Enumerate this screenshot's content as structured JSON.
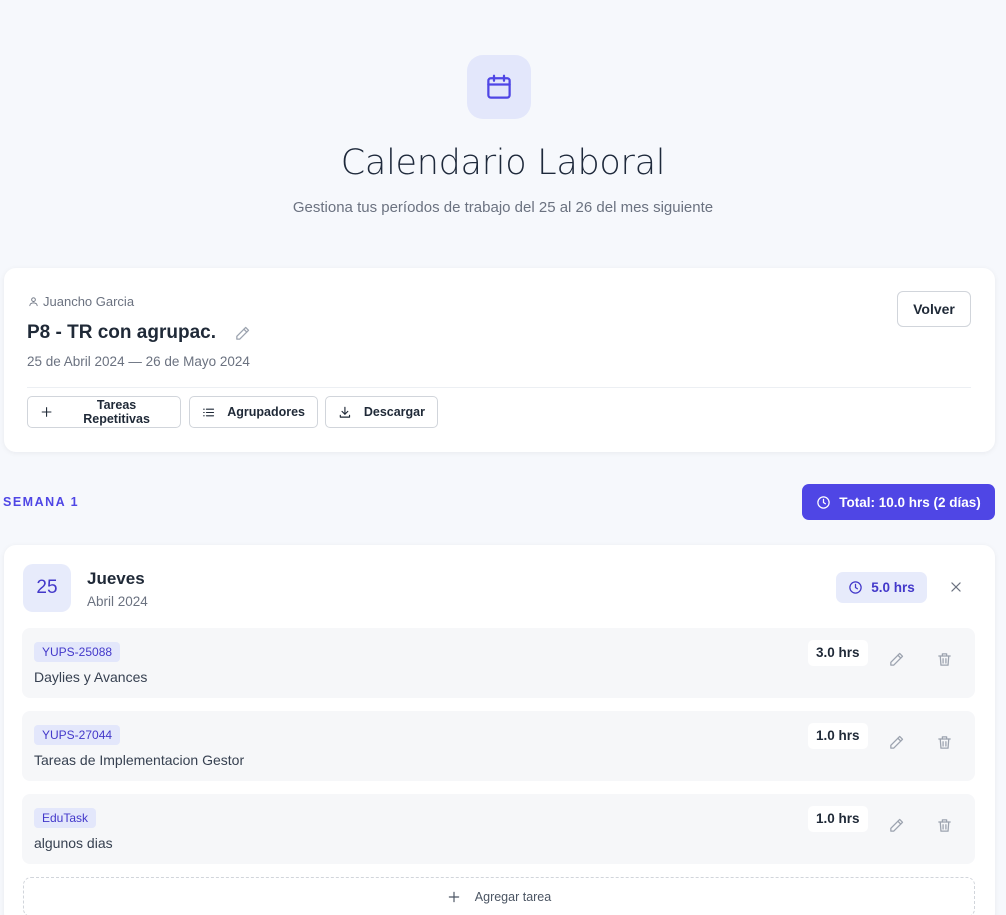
{
  "header": {
    "icon": "calendar-icon",
    "title": "Calendario Laboral",
    "subtitle": "Gestiona tus períodos de trabajo del 25 al 26 del mes siguiente"
  },
  "period": {
    "user_icon": "user-icon",
    "user": "Juancho Garcia",
    "title": "P8 - TR con agrupac.",
    "dates": "25 de Abril 2024 — 26 de Mayo 2024",
    "back_label": "Volver",
    "actions": [
      {
        "icon": "plus-icon",
        "label": "Tareas Repetitivas"
      },
      {
        "icon": "list-icon",
        "label": "Agrupadores"
      },
      {
        "icon": "download-icon",
        "label": "Descargar"
      }
    ]
  },
  "week": {
    "label": "SEMANA 1",
    "total_label": "Total: 10.0 hrs (2 días)"
  },
  "day": {
    "number": "25",
    "name": "Jueves",
    "month": "Abril 2024",
    "hours": "5.0 hrs",
    "tasks": [
      {
        "tag": "YUPS-25088",
        "description": "Daylies y Avances",
        "hours": "3.0 hrs"
      },
      {
        "tag": "YUPS-27044",
        "description": "Tareas de Implementacion Gestor",
        "hours": "1.0 hrs"
      },
      {
        "tag": "EduTask",
        "description": "algunos dias",
        "hours": "1.0 hrs"
      }
    ],
    "add_task_label": "Agregar tarea"
  },
  "colors": {
    "accent": "#4f46e5",
    "accent_soft": "#e7ebfb",
    "page_bg": "#f6f8fc"
  }
}
